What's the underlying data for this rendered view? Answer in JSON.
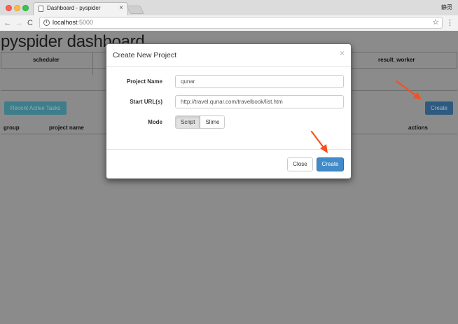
{
  "browser": {
    "tab_title": "Dashboard - pyspider",
    "tab_close": "×",
    "profile_name": "静觅",
    "url_host": "localhost",
    "url_port": ":5000",
    "nav_back": "←",
    "nav_forward": "→",
    "nav_reload": "C",
    "info_symbol": "i",
    "bookmark_symbol": "☆",
    "menu_symbol": "⋮"
  },
  "page": {
    "title": "pyspider dashboard",
    "stats_headers": {
      "scheduler": "scheduler",
      "result_worker": "result_worker"
    },
    "recent_tasks_label": "Recent Active Tasks",
    "create_label": "Create",
    "table_headers": {
      "group": "group",
      "project_name": "project name",
      "actions": "actions"
    }
  },
  "modal": {
    "title": "Create New Project",
    "close_symbol": "×",
    "project_name_label": "Project Name",
    "project_name_value": "qunar",
    "start_url_label": "Start URL(s)",
    "start_url_value": "http://travel.qunar.com/travelbook/list.htm",
    "mode_label": "Mode",
    "mode_options": [
      "Script",
      "Slime"
    ],
    "mode_selected": "Script",
    "close_label": "Close",
    "create_label": "Create"
  },
  "colors": {
    "primary": "#428bca",
    "info": "#5bc0de",
    "arrow": "#f4511e"
  }
}
